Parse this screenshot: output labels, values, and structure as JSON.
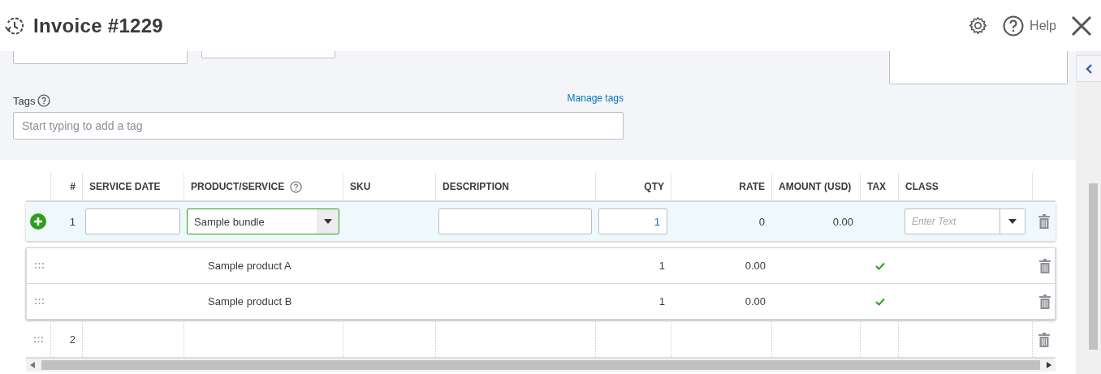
{
  "header": {
    "title": "Invoice #1229",
    "help_label": "Help"
  },
  "tags": {
    "label": "Tags",
    "manage_link": "Manage tags",
    "placeholder": "Start typing to add a tag"
  },
  "table": {
    "columns": [
      "#",
      "SERVICE DATE",
      "PRODUCT/SERVICE",
      "SKU",
      "DESCRIPTION",
      "QTY",
      "RATE",
      "AMOUNT (USD)",
      "TAX",
      "CLASS"
    ],
    "rows": [
      {
        "kind": "editing",
        "number": "1",
        "service_date": "",
        "product": "Sample bundle",
        "product_active": true,
        "description": "",
        "qty": "1",
        "rate": "0",
        "amount": "0.00",
        "class_placeholder": "Enter Text",
        "components": [
          {
            "name": "Sample product A",
            "qty": "1",
            "rate": "0.00",
            "taxable": true
          },
          {
            "name": "Sample product B",
            "qty": "1",
            "rate": "0.00",
            "taxable": true
          }
        ]
      },
      {
        "kind": "blank",
        "number": "2"
      }
    ]
  }
}
